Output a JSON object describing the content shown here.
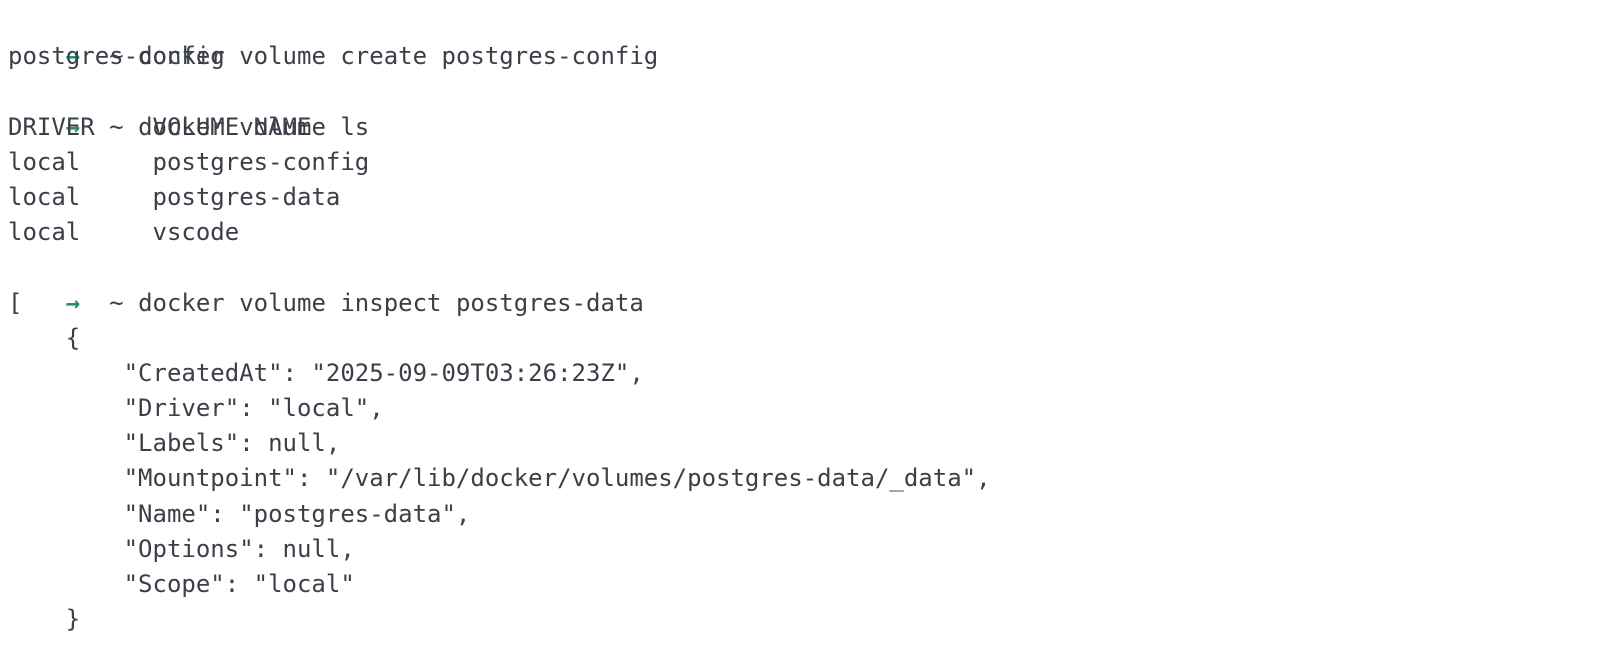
{
  "colors": {
    "background": "#ffffff",
    "text": "#3b4048",
    "prompt_arrow": "#2e8b75"
  },
  "terminal": {
    "prompt": {
      "arrow": "→",
      "dir": "~"
    },
    "lines": [
      {
        "kind": "cmd",
        "text": "docker volume create postgres-config"
      },
      {
        "kind": "out",
        "text": "postgres-config"
      },
      {
        "kind": "cmd",
        "text": "docker volume ls"
      },
      {
        "kind": "out",
        "text": "DRIVER    VOLUME NAME"
      },
      {
        "kind": "out",
        "text": "local     postgres-config"
      },
      {
        "kind": "out",
        "text": "local     postgres-data"
      },
      {
        "kind": "out",
        "text": "local     vscode"
      },
      {
        "kind": "cmd",
        "text": "docker volume inspect postgres-data"
      },
      {
        "kind": "out",
        "text": "["
      },
      {
        "kind": "out",
        "text": "    {"
      },
      {
        "kind": "out",
        "text": "        \"CreatedAt\": \"2025-09-09T03:26:23Z\","
      },
      {
        "kind": "out",
        "text": "        \"Driver\": \"local\","
      },
      {
        "kind": "out",
        "text": "        \"Labels\": null,"
      },
      {
        "kind": "out",
        "text": "        \"Mountpoint\": \"/var/lib/docker/volumes/postgres-data/_data\","
      },
      {
        "kind": "out",
        "text": "        \"Name\": \"postgres-data\","
      },
      {
        "kind": "out",
        "text": "        \"Options\": null,"
      },
      {
        "kind": "out",
        "text": "        \"Scope\": \"local\""
      },
      {
        "kind": "out",
        "text": "    }"
      }
    ]
  }
}
